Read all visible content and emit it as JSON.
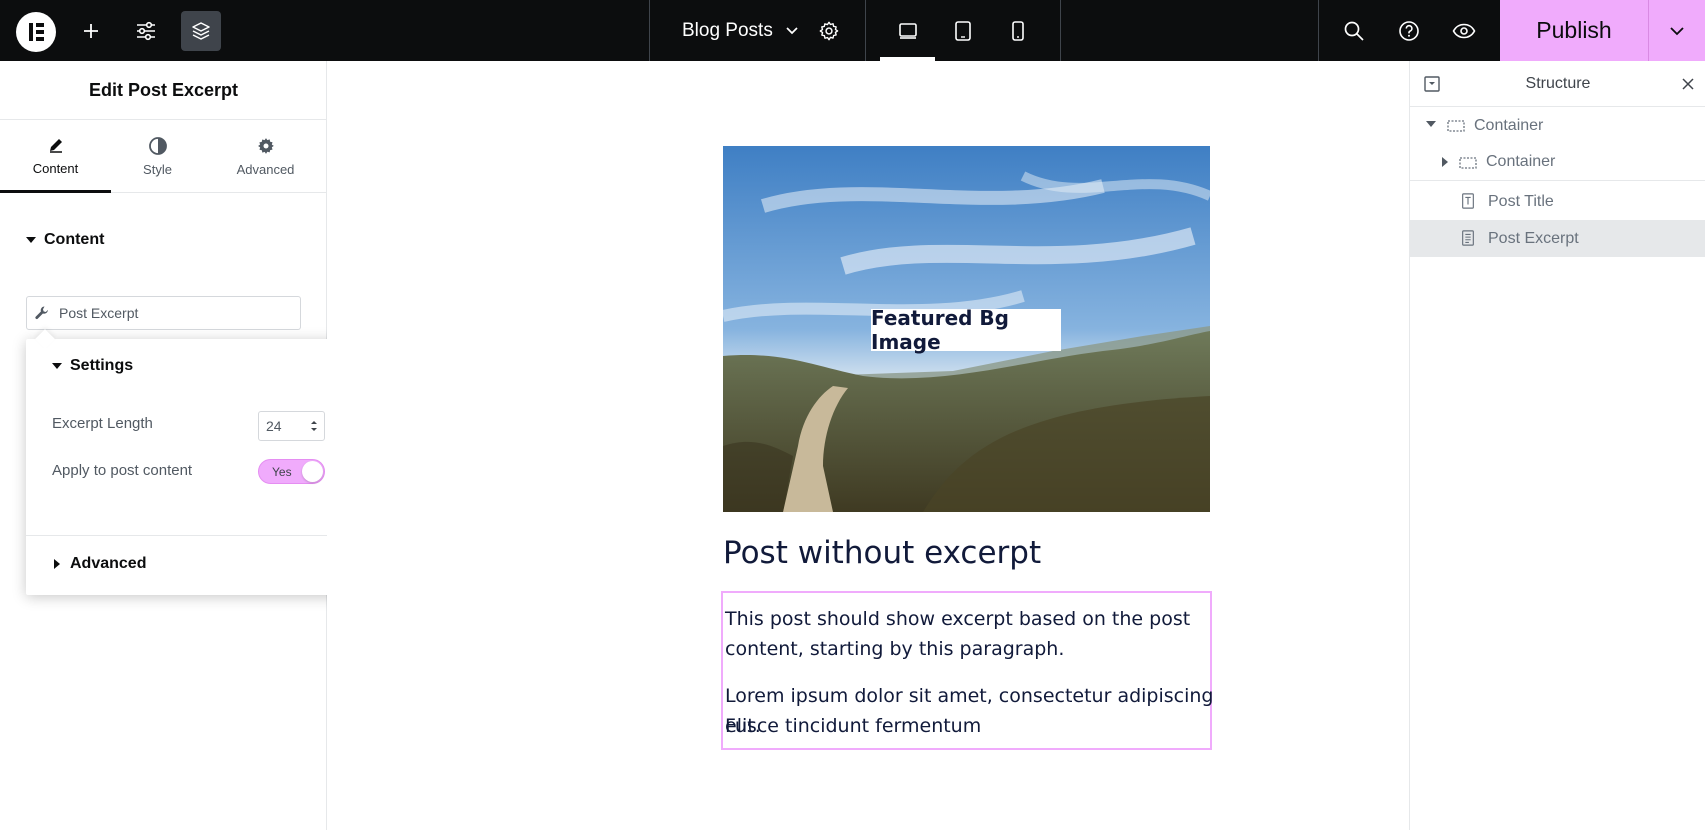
{
  "topbar": {
    "document_title": "Blog Posts",
    "publish_label": "Publish"
  },
  "left_panel": {
    "title": "Edit Post Excerpt",
    "tabs": [
      {
        "label": "Content"
      },
      {
        "label": "Style"
      },
      {
        "label": "Advanced"
      }
    ],
    "section_label": "Content",
    "dynamic_field_label": "Post Excerpt"
  },
  "settings_popover": {
    "heading": "Settings",
    "excerpt_length_label": "Excerpt Length",
    "excerpt_length_value": "24",
    "apply_label": "Apply to post content",
    "apply_toggle_label": "Yes",
    "advanced_label": "Advanced"
  },
  "canvas": {
    "featured_label": "Featured Bg Image",
    "post_title": "Post without excerpt",
    "excerpt_p1_line1": "This post should show excerpt based on the post",
    "excerpt_p1_line2": "content, starting by this paragraph.",
    "excerpt_p2_line1": "Lorem ipsum dolor sit amet, consectetur adipiscing elit.",
    "excerpt_p2_line2": "Fusce tincidunt fermentum"
  },
  "structure": {
    "title": "Structure",
    "items": [
      {
        "label": "Container"
      },
      {
        "label": "Container"
      },
      {
        "label": "Post Title"
      },
      {
        "label": "Post Excerpt"
      }
    ]
  },
  "colors": {
    "accent": "#f0abfc",
    "topbar": "#0c0d0e",
    "text_dark": "#111a3a"
  }
}
